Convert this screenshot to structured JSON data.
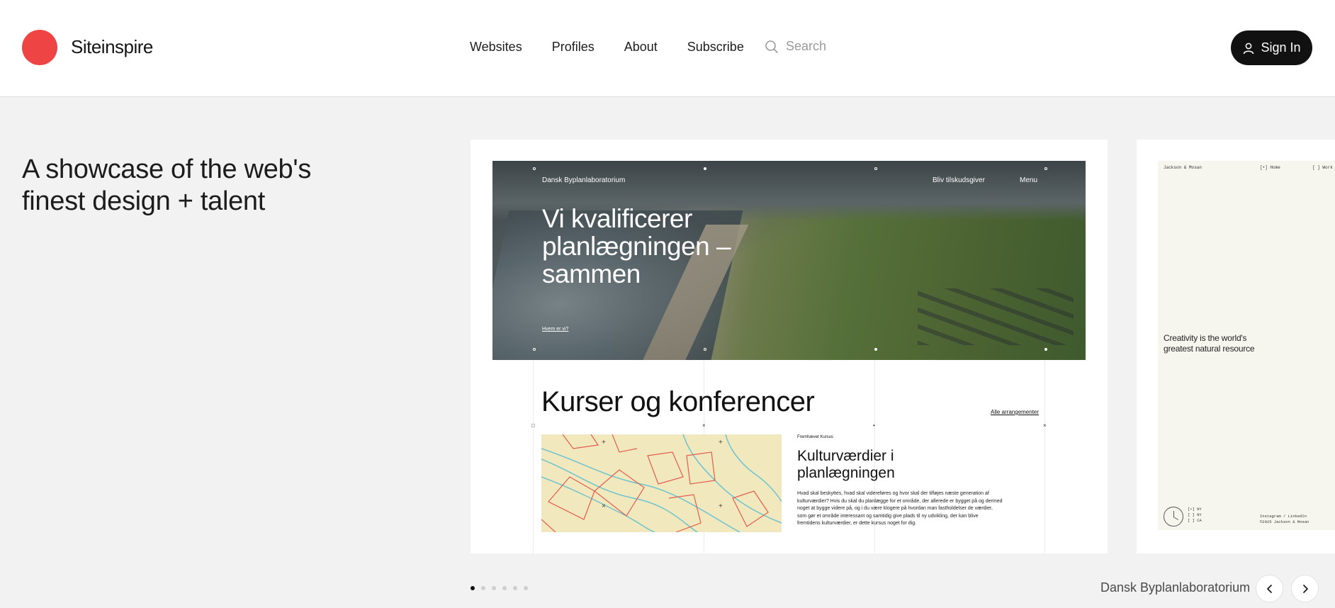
{
  "brand": {
    "name": "Siteinspire",
    "accent": "#ef4444"
  },
  "nav": {
    "items": [
      "Websites",
      "Profiles",
      "About",
      "Subscribe"
    ]
  },
  "search": {
    "placeholder": "Search",
    "icon": "search-icon"
  },
  "signin": {
    "label": "Sign In",
    "icon": "user-icon"
  },
  "tagline": "A showcase of the web's finest design + talent",
  "featured": {
    "brand": "Dansk Byplanlaboratorium",
    "link_sponsor": "Bliv tilskudsgiver",
    "link_menu": "Menu",
    "hero_title": "Vi kvalificerer planlægningen – sammen",
    "hero_cta": "Hvem er vi?",
    "section_title": "Kurser og konferencer",
    "section_link": "Alle arrangementer",
    "course_tag": "Fremhævet Kursus",
    "course_title": "Kulturværdier i planlægningen",
    "course_desc": "Hvad skal beskyttes, hvad skal videreføres og hvor skal der tilføjes næste generation af kulturværdier? Hvis du skal du planlægge for et område, der allerede er bygget på og dermed noget at bygge videre på, og i du være klogere på hvordan man fastholdelser de værdier, som gør et område interessant og samtidig give plads til ny udvikling, der kan blive fremtidens kulturværdier, er dette kursus noget for dig."
  },
  "second_card": {
    "brand": "Jackson & Mosan",
    "home": "[•] Home",
    "work": "[ ] Work",
    "quote": "Creativity is the world's greatest natural resource",
    "cities": [
      "[•] NY",
      "[ ] NY",
      "[ ] CA"
    ],
    "social": [
      "Instagram / LinkedIn",
      "©2025 Jackson & Mosan"
    ]
  },
  "pager": {
    "count": 6,
    "active": 0
  },
  "current_site": "Dansk Byplanlaboratorium",
  "controls": {
    "prev_icon": "chevron-left-icon",
    "next_icon": "chevron-right-icon"
  }
}
